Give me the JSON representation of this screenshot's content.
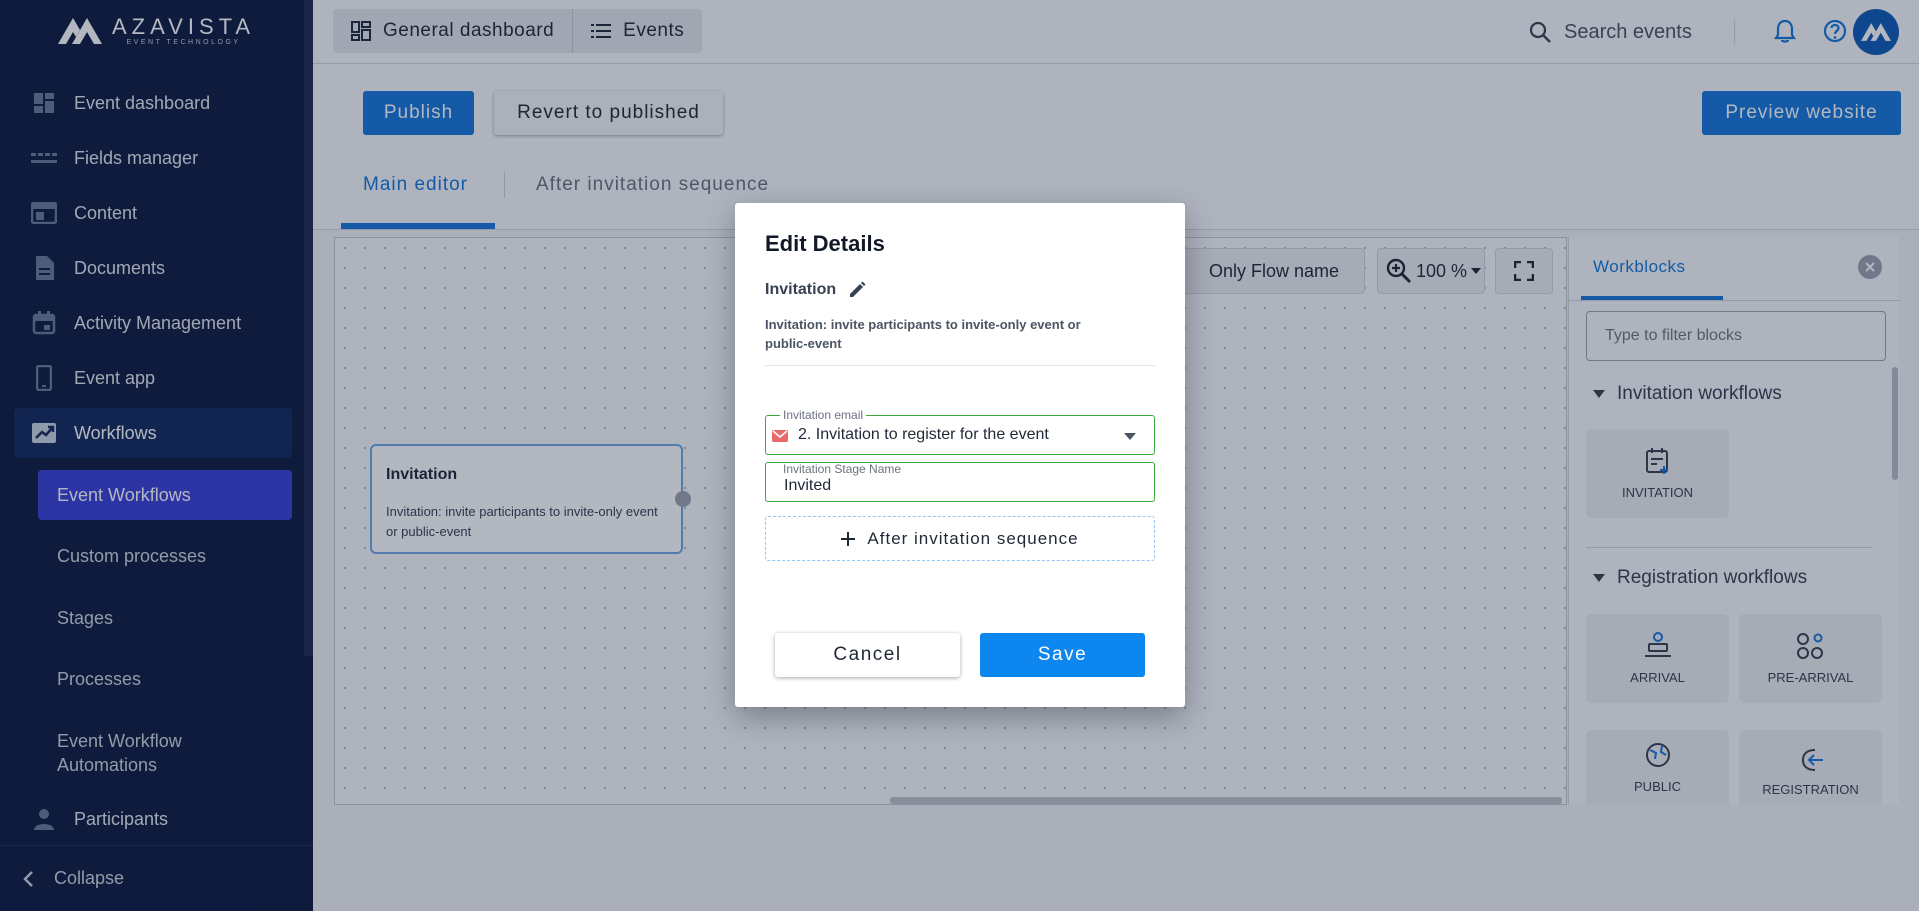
{
  "brand": {
    "name": "AZAVISTA",
    "tagline": "EVENT TECHNOLOGY"
  },
  "sidebar": {
    "items": [
      {
        "label": "Event dashboard",
        "icon": "dashboard-icon"
      },
      {
        "label": "Fields manager",
        "icon": "fields-icon"
      },
      {
        "label": "Content",
        "icon": "content-icon"
      },
      {
        "label": "Documents",
        "icon": "document-icon"
      },
      {
        "label": "Activity Management",
        "icon": "calendar-icon"
      },
      {
        "label": "Event app",
        "icon": "phone-icon"
      },
      {
        "label": "Workflows",
        "icon": "workflow-icon"
      },
      {
        "label": "Participants",
        "icon": "person-icon"
      }
    ],
    "subitems": [
      {
        "label": "Event Workflows"
      },
      {
        "label": "Custom processes"
      },
      {
        "label": "Stages"
      },
      {
        "label": "Processes"
      },
      {
        "label": "Event Workflow Automations"
      }
    ],
    "collapse_label": "Collapse"
  },
  "topbar": {
    "tabs": [
      {
        "label": "General dashboard",
        "icon": "grid-icon"
      },
      {
        "label": "Events",
        "icon": "list-icon"
      }
    ],
    "search_label": "Search events"
  },
  "toolbar": {
    "publish_label": "Publish",
    "revert_label": "Revert to published",
    "preview_label": "Preview website",
    "editor_tabs": [
      "Main editor",
      "After invitation sequence"
    ]
  },
  "canvas": {
    "node": {
      "title": "Invitation",
      "description": "Invitation: invite participants to invite-only event or public-event"
    },
    "flow_toggle_label": "Only Flow name",
    "zoom_label": "100 %"
  },
  "panel": {
    "tab_label": "Workblocks",
    "filter_placeholder": "Type to filter blocks",
    "sections": [
      {
        "title": "Invitation workflows",
        "blocks": [
          "INVITATION"
        ]
      },
      {
        "title": "Registration workflows",
        "blocks": [
          "ARRIVAL",
          "PRE-ARRIVAL",
          "PUBLIC",
          "REGISTRATION"
        ]
      }
    ]
  },
  "modal": {
    "title": "Edit Details",
    "name": "Invitation",
    "description": "Invitation: invite participants to invite-only event or public-event",
    "email_field": {
      "label": "Invitation email",
      "value": "2. Invitation to register for the event"
    },
    "stage_field": {
      "label": "Invitation Stage Name",
      "value": "Invited"
    },
    "after_sequence_label": "After invitation sequence",
    "cancel_label": "Cancel",
    "save_label": "Save"
  },
  "colors": {
    "primary": "#1677d9",
    "sidebar_bg": "#0c1a3f",
    "selected_sub": "#3a3fd4",
    "valid_border": "#3aa83a"
  }
}
